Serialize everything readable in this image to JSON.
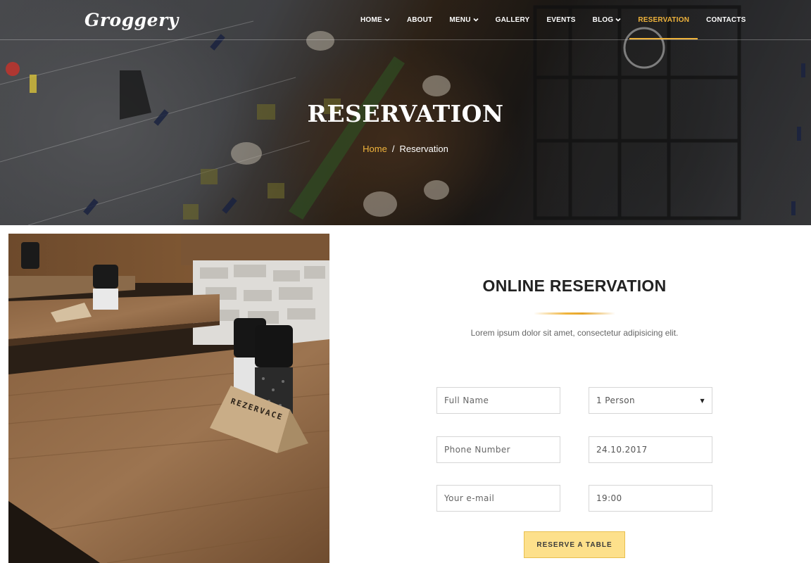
{
  "brand": {
    "logo_text": "Groggery"
  },
  "nav": {
    "items": [
      {
        "label": "HOME",
        "has_dropdown": true,
        "active": false
      },
      {
        "label": "ABOUT",
        "has_dropdown": false,
        "active": false
      },
      {
        "label": "MENU",
        "has_dropdown": true,
        "active": false
      },
      {
        "label": "GALLERY",
        "has_dropdown": false,
        "active": false
      },
      {
        "label": "EVENTS",
        "has_dropdown": false,
        "active": false
      },
      {
        "label": "BLOG",
        "has_dropdown": true,
        "active": false
      },
      {
        "label": "RESERVATION",
        "has_dropdown": false,
        "active": true
      },
      {
        "label": "CONTACTS",
        "has_dropdown": false,
        "active": false
      }
    ]
  },
  "hero": {
    "title": "RESERVATION",
    "breadcrumb": {
      "home": "Home",
      "separator": "/",
      "current": "Reservation"
    }
  },
  "photo": {
    "card_text": "REZERVACE"
  },
  "form": {
    "title": "ONLINE RESERVATION",
    "subtitle": "Lorem ipsum dolor sit amet, consectetur adipisicing elit.",
    "full_name_placeholder": "Full Name",
    "phone_placeholder": "Phone Number",
    "email_placeholder": "Your e-mail",
    "persons_value": "1 Person",
    "date_value": "24.10.2017",
    "time_value": "19:00",
    "submit_label": "RESERVE A TABLE"
  },
  "colors": {
    "accent": "#f0b43c",
    "button_bg": "#fde08b",
    "heading": "#222222"
  },
  "icons": {
    "dropdown": "chevron-down-icon",
    "select_caret": "caret-down-icon"
  }
}
